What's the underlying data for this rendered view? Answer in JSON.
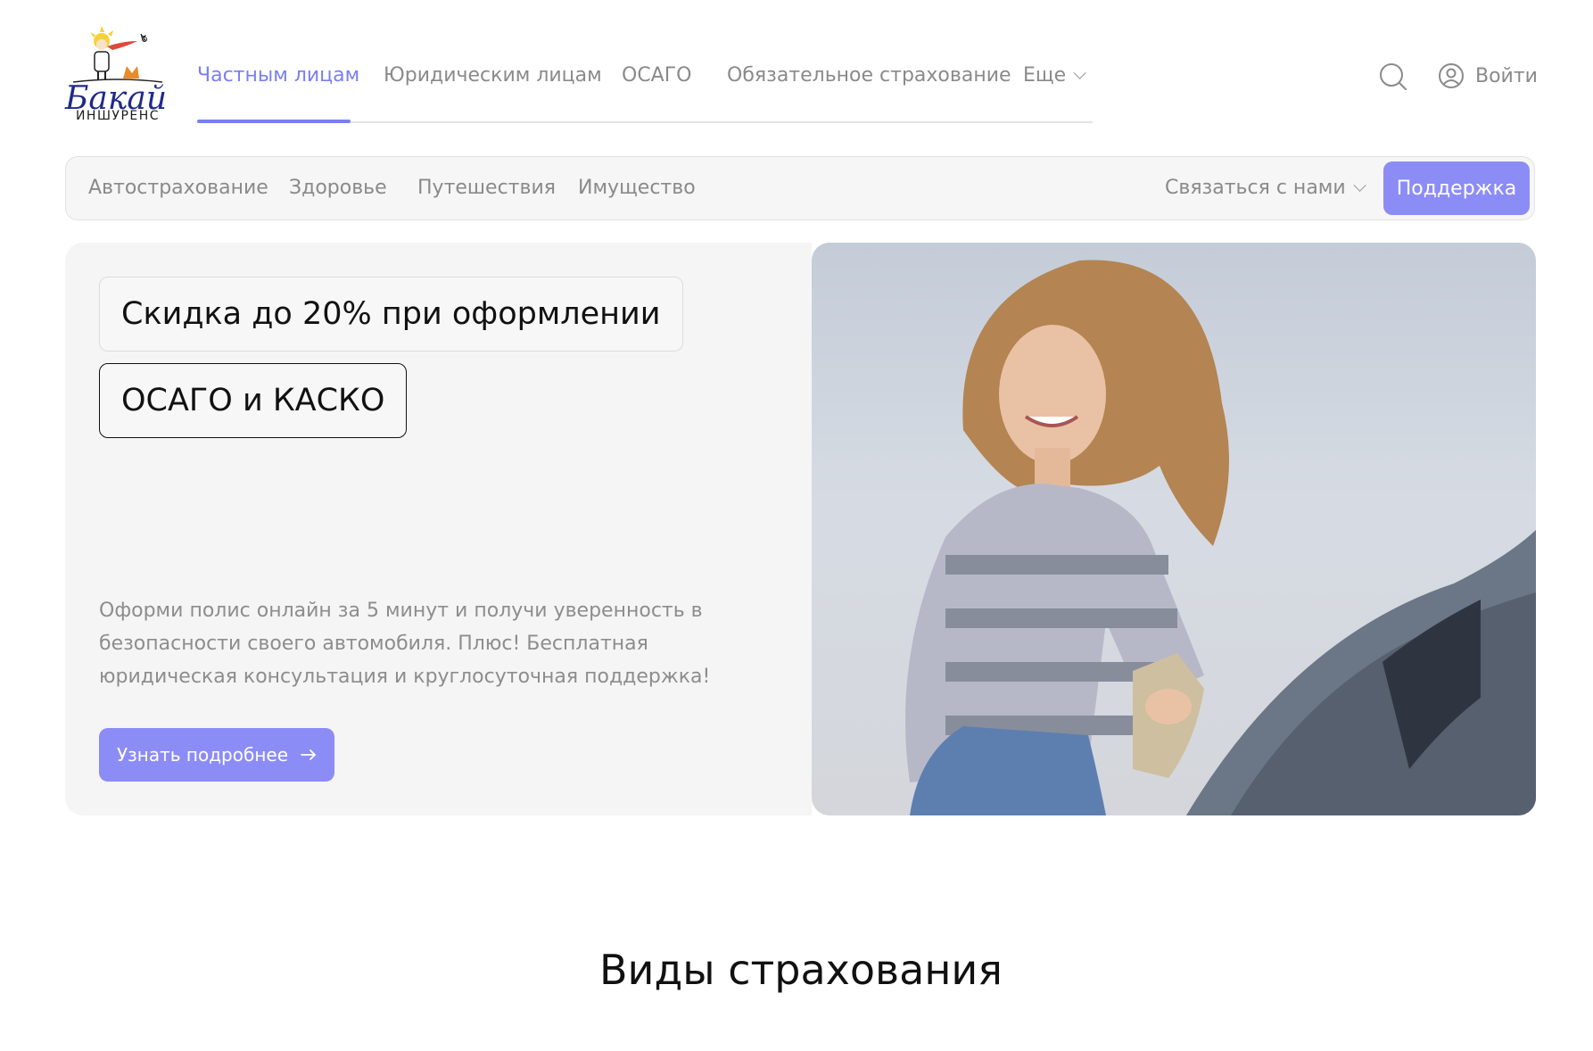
{
  "brand": {
    "logo_script": "Бакай",
    "logo_sub": "ИНШУРЕНС",
    "accent_color": "#7a7fee",
    "button_color": "#8c8cf6"
  },
  "header": {
    "nav": [
      {
        "label": "Частным лицам",
        "active": true
      },
      {
        "label": "Юридическим лицам",
        "active": false
      },
      {
        "label": "ОСАГО",
        "active": false
      },
      {
        "label": "Обязательное страхование",
        "active": false
      },
      {
        "label": "Еще",
        "active": false
      }
    ],
    "login_label": "Войти",
    "icons": [
      "search-icon",
      "user-icon",
      "chevron-down-icon"
    ]
  },
  "subnav": {
    "items": [
      "Автострахование",
      "Здоровье",
      "Путешествия",
      "Имущество"
    ],
    "contact_label": "Связаться с нами",
    "support_label": "Поддержка"
  },
  "hero": {
    "tag1": "Скидка до 20% при оформлении",
    "tag2": "ОСАГО и КАСКО",
    "description": "Оформи полис онлайн за 5 минут и получи уверенность в безопасности своего автомобиля. Плюс! Бесплатная юридическая консультация и круглосуточная поддержка!",
    "cta_label": "Узнать подробнее",
    "cta_icon": "arrow-right-icon",
    "image_alt": "woman-cleaning-car-photo"
  },
  "section": {
    "title": "Виды страхования"
  }
}
